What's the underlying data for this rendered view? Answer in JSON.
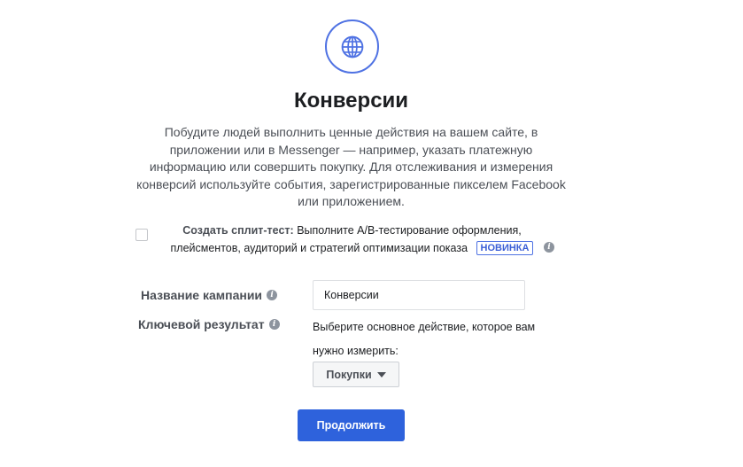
{
  "header": {
    "icon": "globe-icon",
    "title": "Конверсии",
    "description": "Побудите людей выполнить ценные действия на вашем сайте, в приложении или в Messenger — например, указать платежную информацию или совершить покупку. Для отслеживания и измерения конверсий используйте события, зарегистрированные пикселем Facebook или приложением."
  },
  "split_test": {
    "checked": false,
    "bold_label": "Создать сплит-тест:",
    "text": "Выполните A/B-тестирование оформления, плейсментов, аудиторий и стратегий оптимизации показа",
    "badge": "НОВИНКА",
    "info_icon": "info-icon"
  },
  "form": {
    "campaign_name_label": "Название кампании",
    "campaign_name_value": "Конверсии",
    "key_result_label": "Ключевой результат",
    "key_result_help": "Выберите основное действие, которое вам нужно измерить:",
    "key_result_selected": "Покупки"
  },
  "actions": {
    "continue_label": "Продолжить"
  },
  "colors": {
    "accent": "#2e62dc",
    "icon_ring": "#4f72e3"
  }
}
